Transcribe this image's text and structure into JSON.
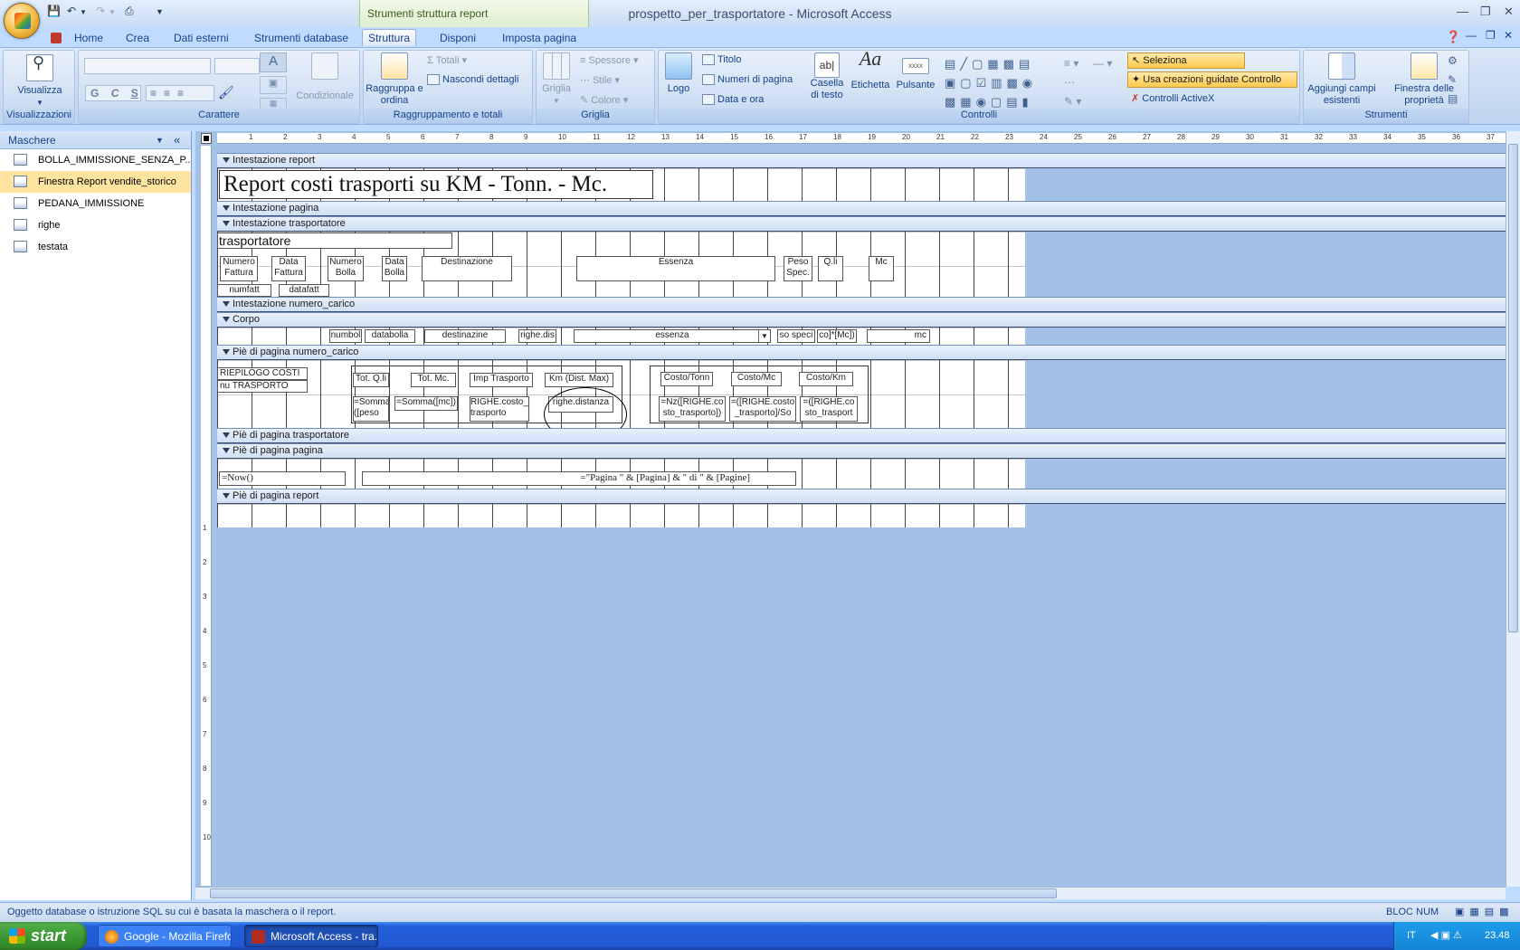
{
  "window": {
    "title": "prospetto_per_trasportatore - Microsoft Access",
    "context_tab_header": "Strumenti struttura report"
  },
  "tabs": [
    "Home",
    "Crea",
    "Dati esterni",
    "Strumenti database",
    "Struttura",
    "Disponi",
    "Imposta pagina"
  ],
  "ribbon": {
    "groups": {
      "visualizzazioni": "Visualizzazioni",
      "carattere": "Carattere",
      "raggruppamento": "Raggruppamento e totali",
      "griglia": "Griglia",
      "controlli": "Controlli",
      "strumenti": "Strumenti"
    },
    "visualizza": "Visualizza",
    "condizionale": "Condizionale",
    "raggruppa": "Raggruppa e ordina",
    "totali": "Totali",
    "nascondi": "Nascondi dettagli",
    "griglia": "Griglia",
    "spessore": "Spessore",
    "stile": "Stile",
    "colore": "Colore",
    "logo": "Logo",
    "titolo": "Titolo",
    "numeri": "Numeri di pagina",
    "data_ora": "Data e ora",
    "casella": "Casella di testo",
    "etichetta": "Etichetta",
    "pulsante": "Pulsante",
    "seleziona": "Seleziona",
    "creazioni": "Usa creazioni guidate Controllo",
    "activex": "Controlli ActiveX",
    "aggiungi": "Aggiungi campi esistenti",
    "finestra": "Finestra delle proprietà",
    "font_bold": "G",
    "font_italic": "C",
    "font_under": "S"
  },
  "nav": {
    "title": "Maschere",
    "items": [
      "BOLLA_IMMISSIONE_SENZA_P...",
      "Finestra Report vendite_storico",
      "PEDANA_IMMISSIONE",
      "righe",
      "testata"
    ]
  },
  "sections": {
    "s1": "Intestazione report",
    "s2": "Intestazione pagina",
    "s3": "Intestazione trasportatore",
    "s4": "Intestazione numero_carico",
    "s5": "Corpo",
    "s6": "Piè di pagina numero_carico",
    "s7": "Piè di pagina trasportatore",
    "s8": "Piè di pagina pagina",
    "s9": "Piè di pagina report"
  },
  "report": {
    "title": "Report costi trasporti su KM - Tonn. - Mc.",
    "trasportatore": "trasportatore",
    "hdr": {
      "numero_fattura": "Numero Fattura",
      "data_fattura": "Data Fattura",
      "numero_bolla": "Numero Bolla",
      "data_bolla": "Data Bolla",
      "destinazione": "Destinazione",
      "essenza": "Essenza",
      "peso_spec": "Peso Spec.",
      "qli": "Q.li",
      "mc": "Mc"
    },
    "numfatt": "numfatt",
    "datafatt": "datafatt",
    "corpo": {
      "numbol": "numbol",
      "databolla": "databolla",
      "destinazione": "destinazine",
      "righe_dis": "righe.dis",
      "essenza": "essenza",
      "peso": "so speci",
      "qli": "co]*[Mc])",
      "mc": "mc"
    },
    "footer": {
      "riepilogo": "RIEPILOGO COSTI",
      "nu_trasporto": "nu TRASPORTO",
      "tot_qli": "Tot. Q.li",
      "tot_mc": "Tot. Mc.",
      "imp_trasporto": "Imp Trasporto",
      "km": "Km (Dist. Max)",
      "costo_tonn": "Costo/Tonn",
      "costo_mc": "Costo/Mc",
      "costo_km": "Costo/Km",
      "somma_peso": "=Somma ([peso",
      "somma_mc": "=Somma([mc])",
      "righe_costo": "RIGHE.costo_ trasporto",
      "righe_distanza": "righe.distanza",
      "nz_righe": "=Nz([RIGHE.co sto_trasporto])",
      "righe_costo_so": "=([RIGHE.costo _trasporto]/So",
      "righe_costo_tr": "=([RIGHE.co sto_trasport"
    },
    "now": "=Now()",
    "pagina": "=\"Pagina \" & [Pagina] & \" di \" & [Pagine]"
  },
  "status": {
    "text": "Oggetto database o istruzione SQL su cui è basata la maschera o il report.",
    "bloc_num": "BLOC NUM"
  },
  "taskbar": {
    "start": "start",
    "firefox": "Google - Mozilla Firefox",
    "access": "Microsoft Access - tra...",
    "lang": "IT",
    "time": "23.48"
  }
}
